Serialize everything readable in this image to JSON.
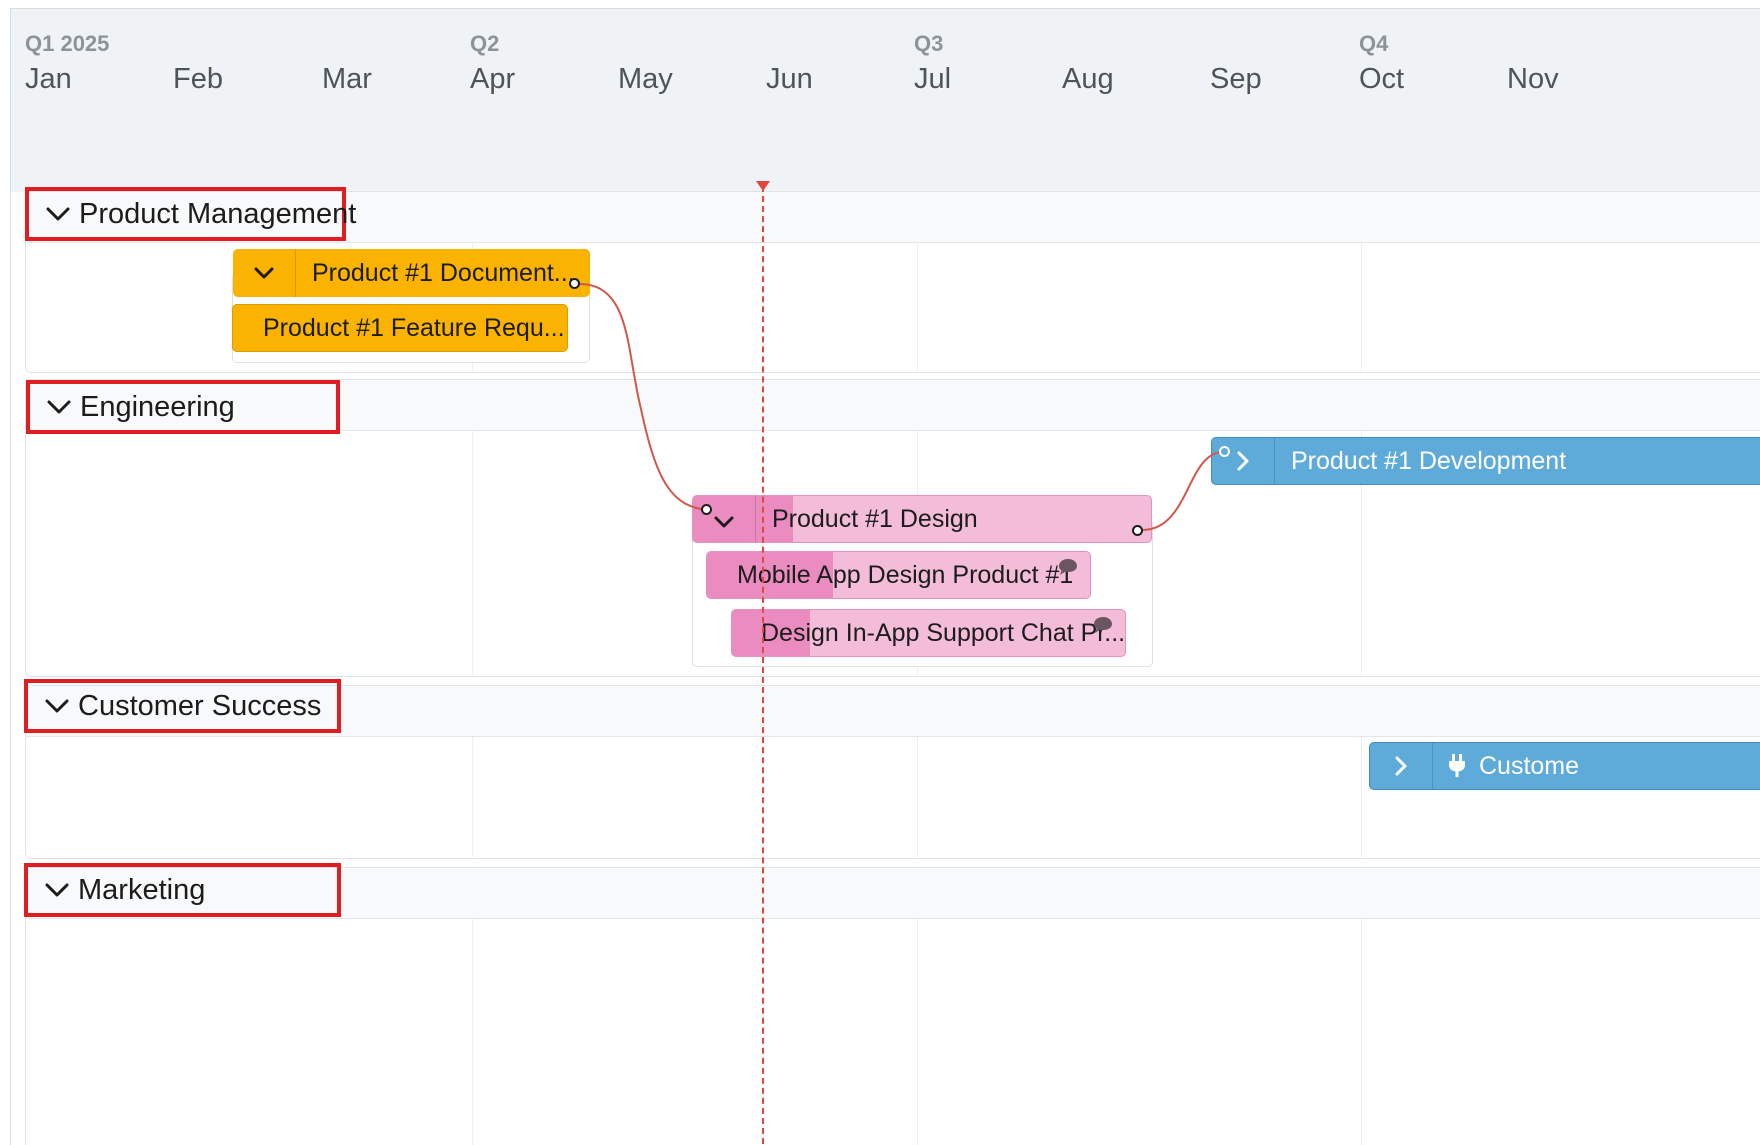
{
  "timeline": {
    "quarters": [
      "Q1 2025",
      "Q2",
      "Q3",
      "Q4"
    ],
    "months": [
      "Jan",
      "Feb",
      "Mar",
      "Apr",
      "May",
      "Jun",
      "Jul",
      "Aug",
      "Sep",
      "Oct",
      "Nov"
    ]
  },
  "sections": [
    {
      "title": "Product Management"
    },
    {
      "title": "Engineering"
    },
    {
      "title": "Customer Success"
    },
    {
      "title": "Marketing"
    }
  ],
  "bars": {
    "pm_parent": "Product #1 Document...",
    "pm_child": "Product #1 Feature Requ...",
    "eng_design": "Product #1 Design",
    "eng_mobile": "Mobile App Design Product #1",
    "eng_support": "Design In-App Support Chat Pr...",
    "eng_dev": "Product #1 Development",
    "cs_bar": "Custome"
  },
  "icons": {
    "section_toggle": "chevron-down-icon",
    "expand": "chevron-right-icon",
    "comment": "comment-icon",
    "plug": "plug-icon"
  },
  "colors": {
    "pm": "#f9b300",
    "design": "#f3bcd9",
    "design_progress": "#ea8cc0",
    "engineering": "#5eaad9",
    "today": "#e0473d",
    "highlight": "#e21d22"
  }
}
